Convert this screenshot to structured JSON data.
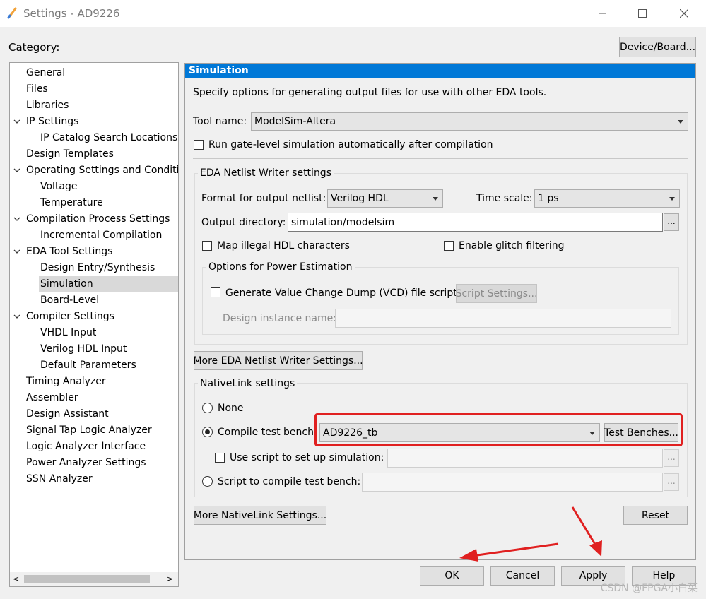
{
  "window": {
    "title": "Settings - AD9226",
    "controls": [
      "minimize-icon",
      "maximize-icon",
      "close-icon"
    ]
  },
  "category_label": "Category:",
  "device_board_button": "Device/Board...",
  "tree": {
    "items": [
      {
        "label": "General",
        "level": 0
      },
      {
        "label": "Files",
        "level": 0
      },
      {
        "label": "Libraries",
        "level": 0
      },
      {
        "label": "IP Settings",
        "level": 0,
        "expanded": true
      },
      {
        "label": "IP Catalog Search Locations",
        "level": 1
      },
      {
        "label": "Design Templates",
        "level": 0
      },
      {
        "label": "Operating Settings and Conditions",
        "level": 0,
        "expanded": true
      },
      {
        "label": "Voltage",
        "level": 1
      },
      {
        "label": "Temperature",
        "level": 1
      },
      {
        "label": "Compilation Process Settings",
        "level": 0,
        "expanded": true
      },
      {
        "label": "Incremental Compilation",
        "level": 1
      },
      {
        "label": "EDA Tool Settings",
        "level": 0,
        "expanded": true
      },
      {
        "label": "Design Entry/Synthesis",
        "level": 1
      },
      {
        "label": "Simulation",
        "level": 1,
        "selected": true
      },
      {
        "label": "Board-Level",
        "level": 1
      },
      {
        "label": "Compiler Settings",
        "level": 0,
        "expanded": true
      },
      {
        "label": "VHDL Input",
        "level": 1
      },
      {
        "label": "Verilog HDL Input",
        "level": 1
      },
      {
        "label": "Default Parameters",
        "level": 1
      },
      {
        "label": "Timing Analyzer",
        "level": 0
      },
      {
        "label": "Assembler",
        "level": 0
      },
      {
        "label": "Design Assistant",
        "level": 0
      },
      {
        "label": "Signal Tap Logic Analyzer",
        "level": 0
      },
      {
        "label": "Logic Analyzer Interface",
        "level": 0
      },
      {
        "label": "Power Analyzer Settings",
        "level": 0
      },
      {
        "label": "SSN Analyzer",
        "level": 0
      }
    ]
  },
  "panel": {
    "header": "Simulation",
    "description": "Specify options for generating output files for use with other EDA tools.",
    "tool_name_label": "Tool name:",
    "tool_name_value": "ModelSim-Altera",
    "run_gate_level_label": "Run gate-level simulation automatically after compilation",
    "eda_netlist": {
      "title": "EDA Netlist Writer settings",
      "format_label": "Format for output netlist:",
      "format_value": "Verilog HDL",
      "time_scale_label": "Time scale:",
      "time_scale_value": "1 ps",
      "output_dir_label": "Output directory:",
      "output_dir_value": "simulation/modelsim",
      "browse_label": "...",
      "map_illegal_label": "Map illegal HDL characters",
      "glitch_label": "Enable glitch filtering",
      "power": {
        "title": "Options for Power Estimation",
        "vcd_label": "Generate Value Change Dump (VCD) file script",
        "script_settings_label": "Script Settings...",
        "design_instance_label": "Design instance name:",
        "design_instance_value": ""
      }
    },
    "more_eda_button": "More EDA Netlist Writer Settings...",
    "nativelink": {
      "title": "NativeLink settings",
      "none_label": "None",
      "compile_tb_label": "Compile test bench:",
      "compile_tb_value": "AD9226_tb",
      "test_benches_button": "Test Benches...",
      "use_script_label": "Use script to set up simulation:",
      "use_script_value": "",
      "script_compile_label": "Script to compile test bench:",
      "script_compile_value": "",
      "browse_label": "..."
    },
    "more_nativelink_button": "More NativeLink Settings...",
    "reset_button": "Reset"
  },
  "footer": {
    "ok": "OK",
    "cancel": "Cancel",
    "apply": "Apply",
    "help": "Help"
  },
  "watermark": "CSDN @FPGA小白菜",
  "colors": {
    "accent": "#0078d7",
    "highlight": "#e02020",
    "selection": "#d9d9d9"
  }
}
